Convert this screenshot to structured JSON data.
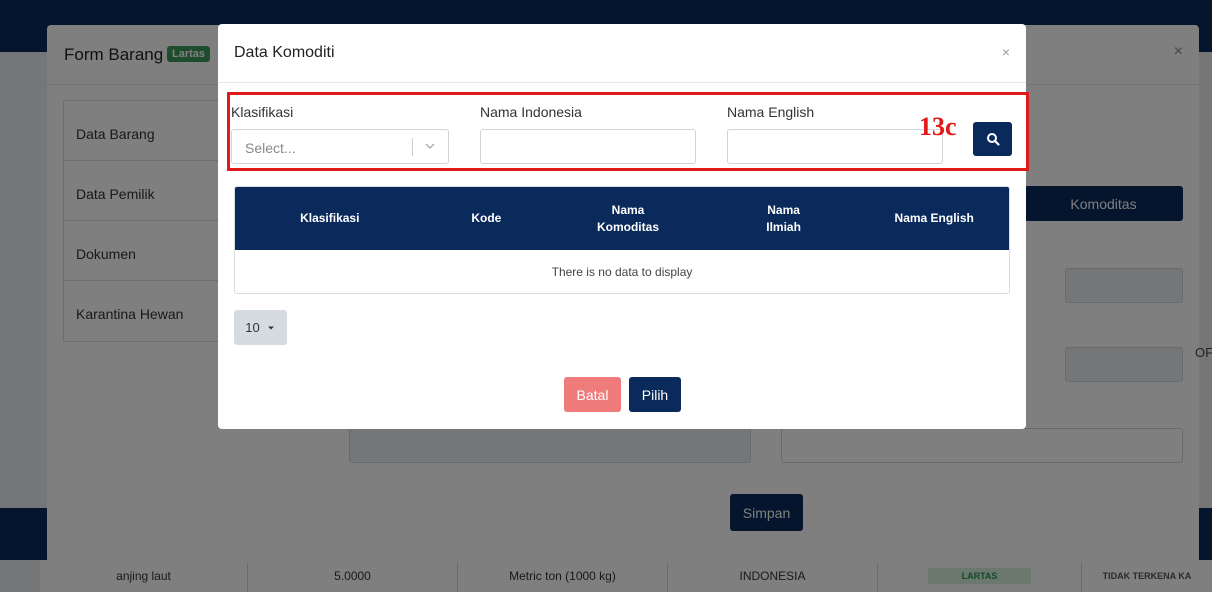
{
  "background": {
    "form_modal": {
      "title": "Form Barang",
      "badge": "Lartas",
      "close_glyph": "×",
      "sidebar": [
        {
          "label": "Data Barang"
        },
        {
          "label": "Data Pemilik"
        },
        {
          "label": "Dokumen"
        },
        {
          "label": "Karantina Hewan"
        }
      ],
      "komoditas_tab": "Komoditas",
      "save_label": "Simpan",
      "cut_text": "OF"
    },
    "table_row": {
      "name": "anjing laut",
      "qty": "5.0000",
      "unit": "Metric ton (1000 kg)",
      "country": "INDONESIA",
      "lartas": "LARTAS",
      "status": "TIDAK TERKENA KA"
    }
  },
  "dialog": {
    "title": "Data Komoditi",
    "close_glyph": "×",
    "filters": {
      "klasifikasi_label": "Klasifikasi",
      "klasifikasi_placeholder": "Select...",
      "nama_indonesia_label": "Nama Indonesia",
      "nama_indonesia_value": "",
      "nama_english_label": "Nama English",
      "nama_english_value": ""
    },
    "annotation": "13c",
    "search_icon": "search-icon",
    "table": {
      "headers": [
        [
          "Klasifikasi"
        ],
        [
          "Kode"
        ],
        [
          "Nama",
          "Komoditas"
        ],
        [
          "Nama",
          "Ilmiah"
        ],
        [
          "Nama English"
        ]
      ],
      "empty_text": "There is no data to display"
    },
    "page_size": "10",
    "cancel_label": "Batal",
    "select_label": "Pilih"
  },
  "colors": {
    "primary": "#0b2a5c",
    "danger": "#ef7b7b",
    "highlight": "#e11919",
    "badge": "#3a9a5a"
  }
}
